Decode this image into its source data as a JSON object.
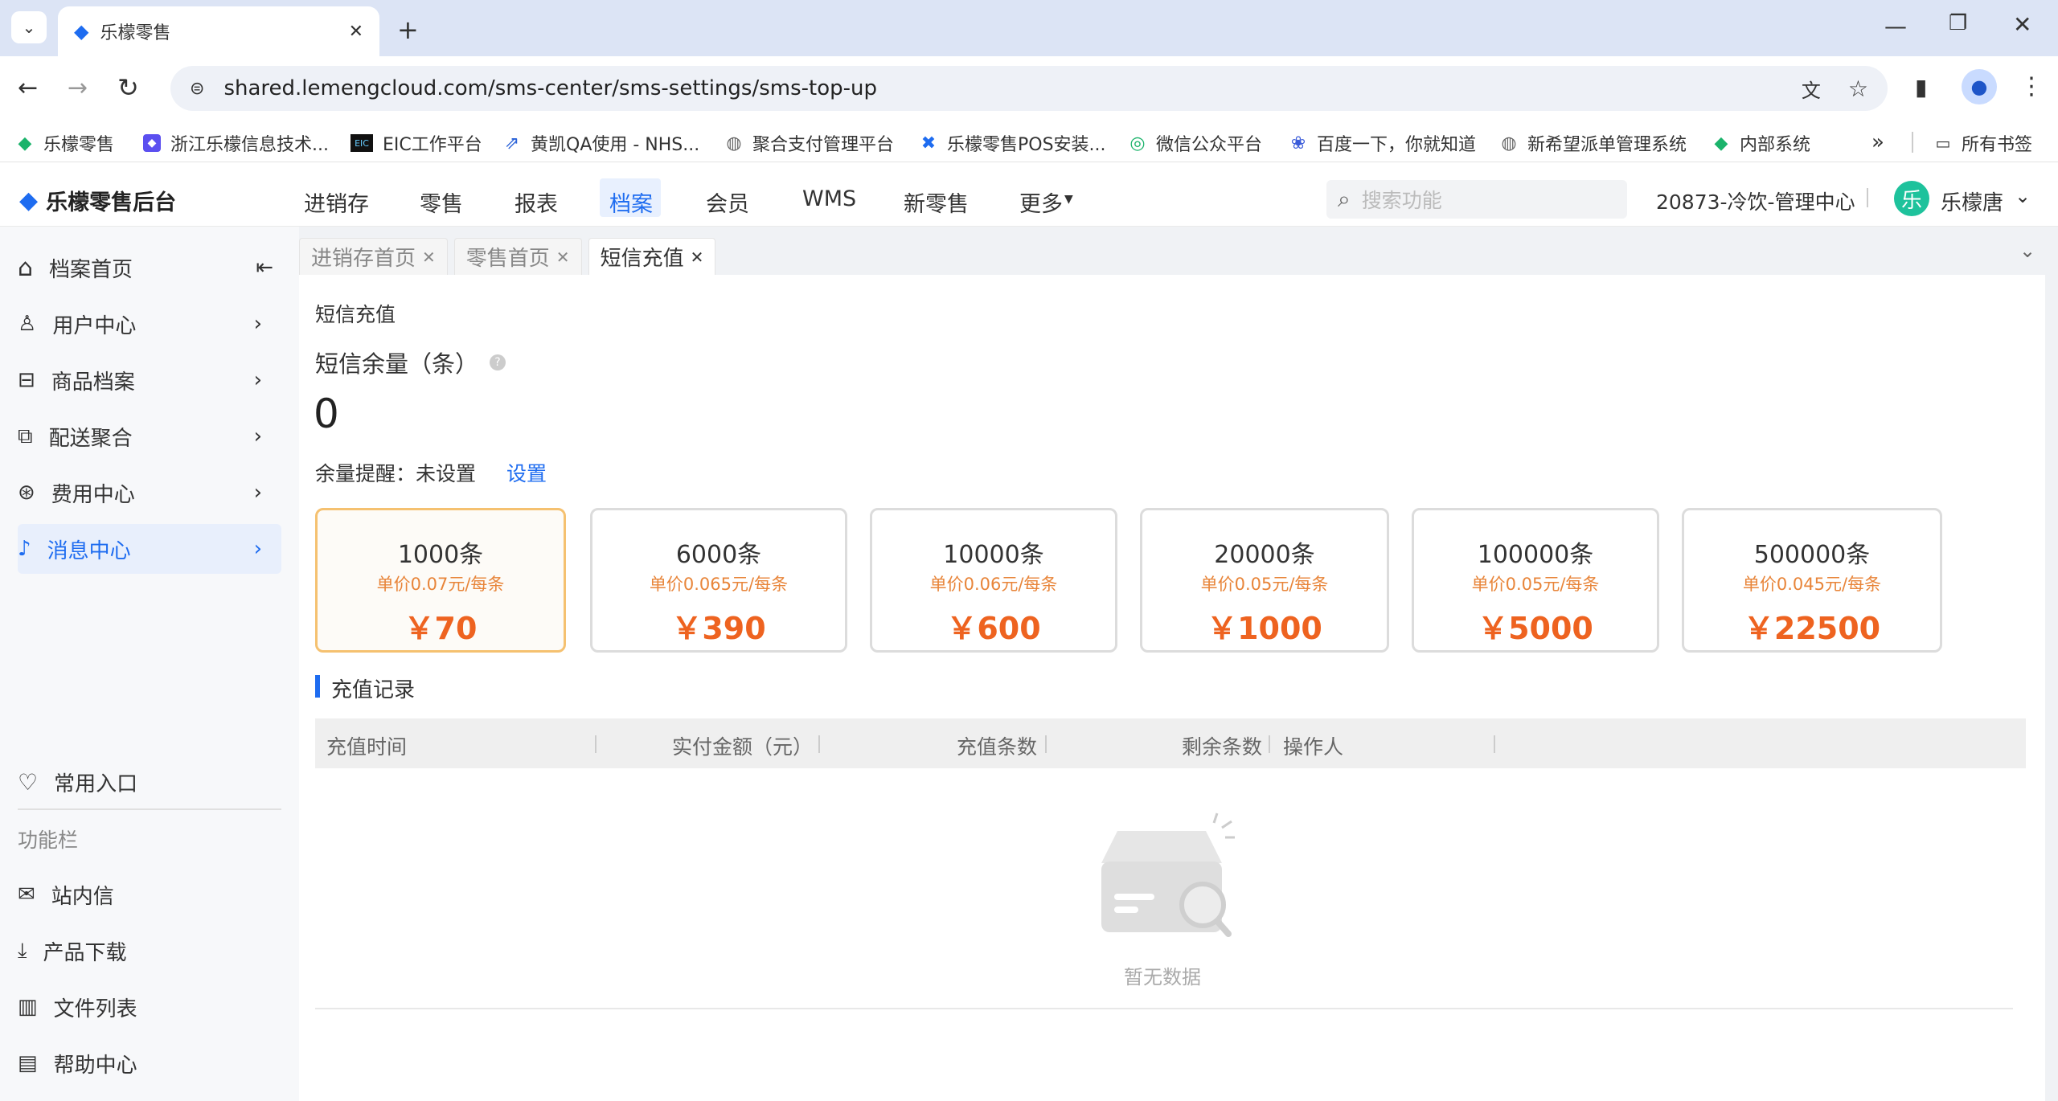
{
  "browser": {
    "tab_title": "乐檬零售",
    "url": "shared.lemengcloud.com/sms-center/sms-settings/sms-top-up",
    "bookmarks": [
      "乐檬零售",
      "浙江乐檬信息技术...",
      "EIC工作平台",
      "黄凯QA使用 - NHS...",
      "聚合支付管理平台",
      "乐檬零售POS安装...",
      "微信公众平台",
      "百度一下，你就知道",
      "新希望派单管理系统",
      "内部系统"
    ],
    "all_bookmarks": "所有书签"
  },
  "app": {
    "logo": "乐檬零售后台",
    "nav": [
      "进销存",
      "零售",
      "报表",
      "档案",
      "会员",
      "WMS",
      "新零售",
      "更多"
    ],
    "active_nav": "档案",
    "search_placeholder": "搜索功能",
    "store": "20873-冷饮-管理中心",
    "avatar_char": "乐",
    "user": "乐檬唐"
  },
  "sidebar": {
    "items": [
      "档案首页",
      "用户中心",
      "商品档案",
      "配送聚合",
      "费用中心",
      "消息中心"
    ],
    "common": "常用入口",
    "section": "功能栏",
    "tools": [
      "站内信",
      "产品下载",
      "文件列表",
      "帮助中心"
    ]
  },
  "tabs": [
    "进销存首页",
    "零售首页",
    "短信充值"
  ],
  "page": {
    "breadcrumb": "短信充值",
    "balance_label": "短信余量（条）",
    "balance_value": "0",
    "reminder_label": "余量提醒：未设置",
    "reminder_link": "设置",
    "packages": [
      {
        "count": "1000条",
        "unit": "单价0.07元/每条",
        "price": "￥70"
      },
      {
        "count": "6000条",
        "unit": "单价0.065元/每条",
        "price": "￥390"
      },
      {
        "count": "10000条",
        "unit": "单价0.06元/每条",
        "price": "￥600"
      },
      {
        "count": "20000条",
        "unit": "单价0.05元/每条",
        "price": "￥1000"
      },
      {
        "count": "100000条",
        "unit": "单价0.05元/每条",
        "price": "￥5000"
      },
      {
        "count": "500000条",
        "unit": "单价0.045元/每条",
        "price": "￥22500"
      }
    ],
    "records_title": "充值记录",
    "columns": [
      "充值时间",
      "实付金额（元）",
      "充值条数",
      "剩余条数",
      "操作人"
    ],
    "empty_text": "暂无数据"
  },
  "colors": {
    "accent": "#1e6cf0",
    "price": "#ee6320",
    "selected_border": "#f5c170"
  }
}
